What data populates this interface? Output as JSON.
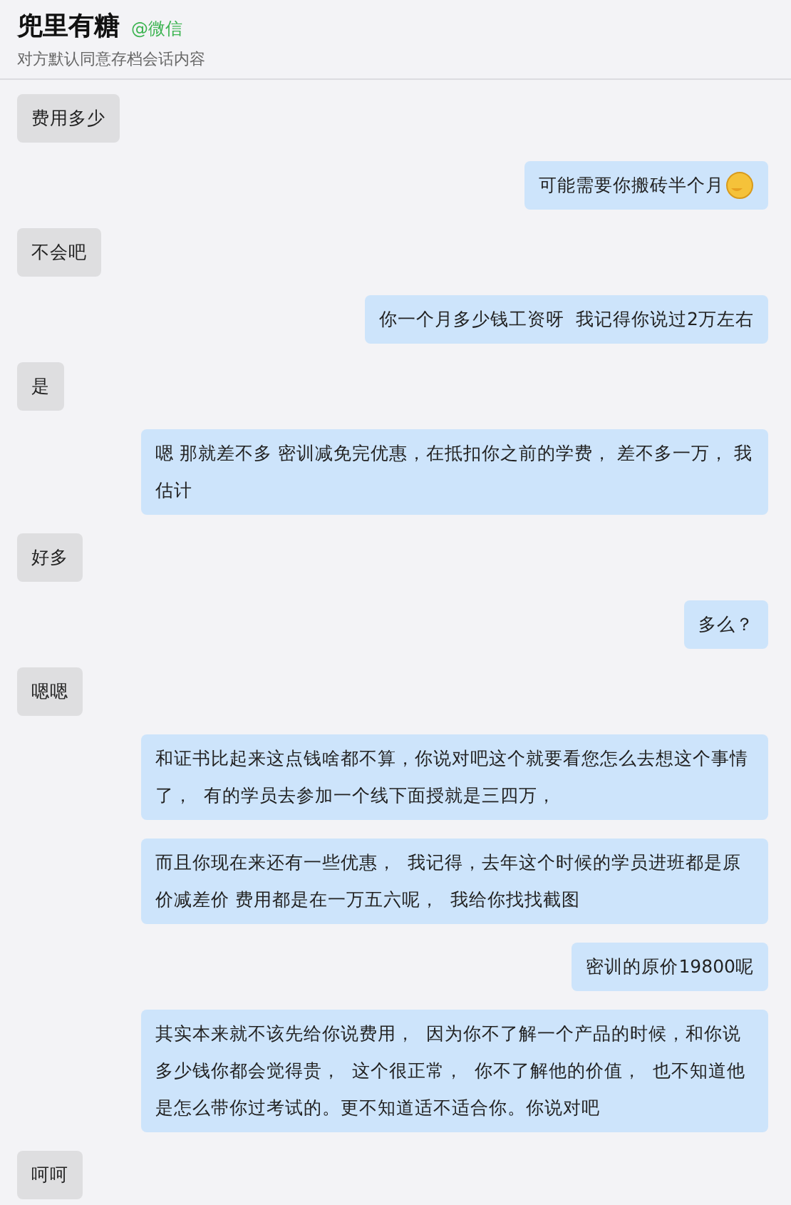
{
  "header": {
    "name": "兜里有糖",
    "source": "@微信",
    "notice": "对方默认同意存档会话内容"
  },
  "messages": [
    {
      "kind": "received",
      "text": "费用多少"
    },
    {
      "kind": "sent",
      "text": "可能需要你搬砖半个月",
      "emoji": true
    },
    {
      "kind": "received",
      "text": "不会吧"
    },
    {
      "kind": "sent",
      "text": "你一个月多少钱工资呀  我记得你说过2万左右"
    },
    {
      "kind": "received",
      "text": "是"
    },
    {
      "kind": "sent",
      "text": "嗯 那就差不多 密训减免完优惠，在抵扣你之前的学费， 差不多一万， 我估计"
    },
    {
      "kind": "received",
      "text": "好多"
    },
    {
      "kind": "sent",
      "text": "多么？"
    },
    {
      "kind": "received",
      "text": "嗯嗯"
    },
    {
      "kind": "sent",
      "text": "和证书比起来这点钱啥都不算，你说对吧这个就要看您怎么去想这个事情了，  有的学员去参加一个线下面授就是三四万，"
    },
    {
      "kind": "sent",
      "text": "而且你现在来还有一些优惠，  我记得，去年这个时候的学员进班都是原价减差价 费用都是在一万五六呢，  我给你找找截图"
    },
    {
      "kind": "sent",
      "text": "密训的原价19800呢"
    },
    {
      "kind": "sent",
      "text": "其实本来就不该先给你说费用，  因为你不了解一个产品的时候，和你说多少钱你都会觉得贵，  这个很正常，  你不了解他的价值，  也不知道他是怎么带你过考试的。更不知道适不适合你。你说对吧"
    },
    {
      "kind": "received",
      "text": "呵呵"
    }
  ]
}
